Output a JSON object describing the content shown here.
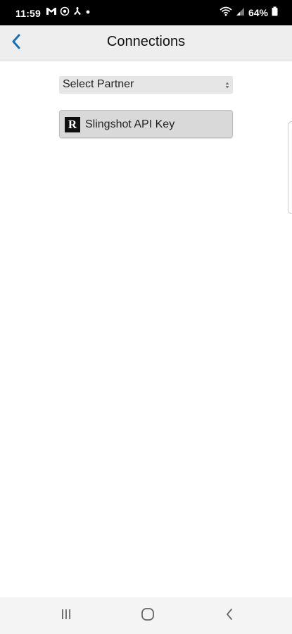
{
  "status_bar": {
    "time": "11:59",
    "battery_percent": "64%",
    "icons_left": [
      "gmail-icon",
      "location-icon",
      "fan-icon",
      "notification-dot-icon"
    ],
    "icons_right": [
      "wifi-icon",
      "signal-icon",
      "battery-icon"
    ]
  },
  "header": {
    "title": "Connections",
    "back_icon": "chevron-left-icon"
  },
  "partner_select": {
    "selected": "Select Partner"
  },
  "slingshot_button": {
    "logo_letter": "R",
    "label": "Slingshot API Key"
  },
  "nav_bar": {
    "buttons": [
      "recent-apps-icon",
      "home-icon",
      "back-icon"
    ]
  },
  "colors": {
    "accent": "#1a6fb3",
    "header_bg": "#eeeeee",
    "status_bg": "#000000",
    "button_bg": "#d9d9d9"
  }
}
